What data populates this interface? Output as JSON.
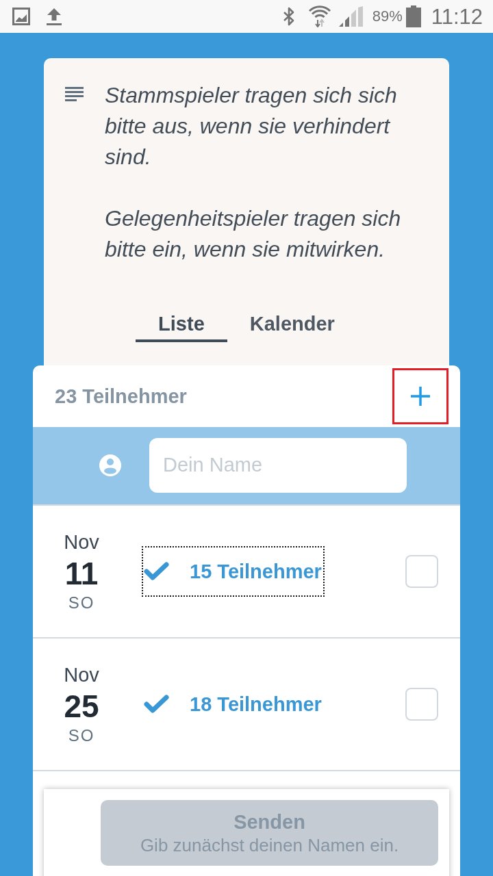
{
  "status_bar": {
    "battery": "89%",
    "time": "11:12"
  },
  "notice": {
    "paragraphs": [
      "Stammspieler tragen sich sich bitte aus, wenn sie verhindert sind.",
      "Gelegenheitspieler tragen sich bitte ein, wenn sie mitwirken."
    ]
  },
  "tabs": [
    {
      "label": "Liste",
      "selected": true
    },
    {
      "label": "Kalender",
      "selected": false
    }
  ],
  "participants": {
    "title": "23 Teilnehmer",
    "add_highlighted": true
  },
  "name_field": {
    "placeholder": "Dein Name"
  },
  "dates": [
    {
      "month": "Nov",
      "day": "11",
      "weekday": "SO",
      "count": "15 Teilnehmer",
      "focused": true,
      "checked": false
    },
    {
      "month": "Nov",
      "day": "25",
      "weekday": "SO",
      "count": "18 Teilnehmer",
      "focused": false,
      "checked": false
    }
  ],
  "submit": {
    "label": "Senden",
    "hint": "Gib zunächst deinen Namen ein.",
    "disabled": true
  }
}
